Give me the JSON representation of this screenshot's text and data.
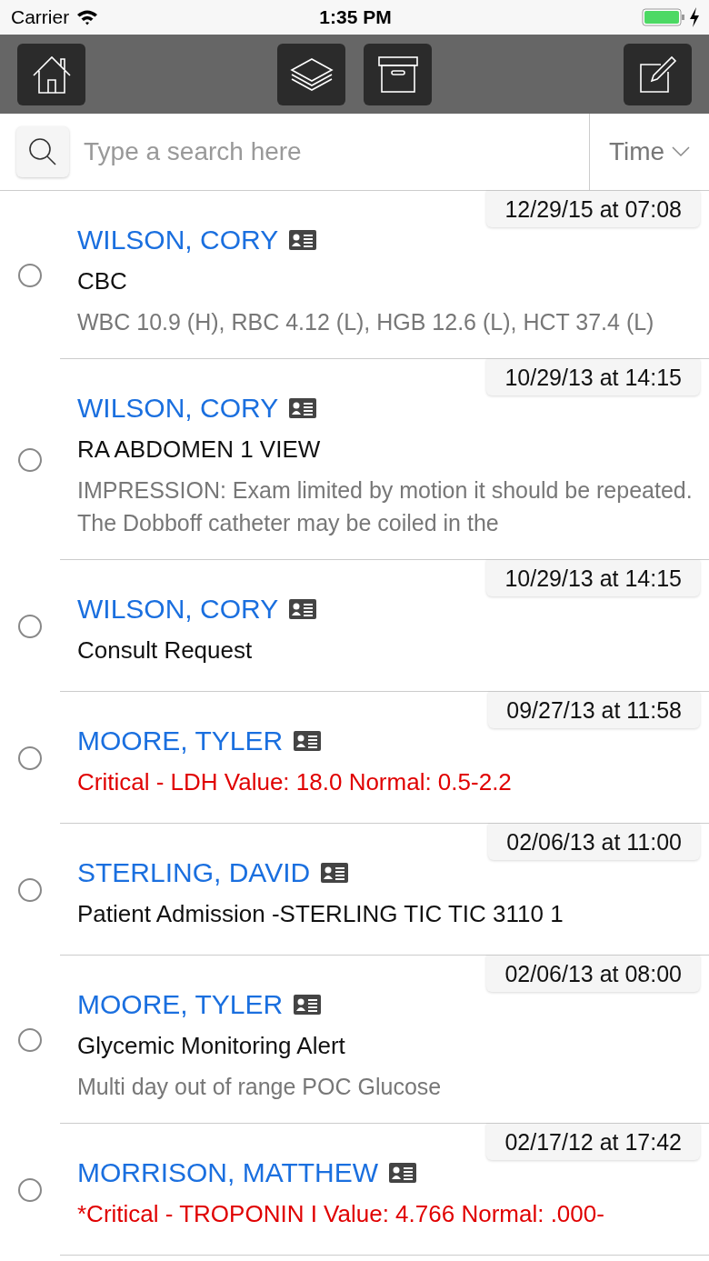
{
  "status_bar": {
    "carrier": "Carrier",
    "time": "1:35 PM",
    "charging": true
  },
  "search": {
    "placeholder": "Type a search here"
  },
  "sort": {
    "label": "Time"
  },
  "messages": [
    {
      "date": "12/29/15 at 07:08",
      "patient": "WILSON, CORY",
      "title": "CBC",
      "kind": "normal",
      "detail": "WBC 10.9 (H), RBC 4.12 (L), HGB 12.6 (L), HCT 37.4 (L)",
      "selected": false
    },
    {
      "date": "10/29/13 at 14:15",
      "patient": "WILSON, CORY",
      "title": "RA ABDOMEN 1 VIEW",
      "kind": "normal",
      "detail": "IMPRESSION: Exam limited by motion it should be repeated. The Dobboff catheter may be coiled in the",
      "selected": false
    },
    {
      "date": "10/29/13 at 14:15",
      "patient": "WILSON, CORY",
      "title": "Consult Request",
      "kind": "normal",
      "selected": false
    },
    {
      "date": "09/27/13 at 11:58",
      "patient": "MOORE, TYLER",
      "title": "Critical - LDH Value: 18.0 Normal: 0.5-2.2",
      "kind": "critical",
      "selected": false
    },
    {
      "date": "02/06/13 at 11:00",
      "patient": "STERLING, DAVID",
      "title": "Patient Admission -STERLING TIC TIC 3110 1",
      "kind": "normal",
      "selected": false
    },
    {
      "date": "02/06/13 at 08:00",
      "patient": "MOORE, TYLER",
      "title": "Glycemic Monitoring Alert",
      "kind": "normal",
      "detail": "Multi day out of range POC Glucose",
      "selected": false
    },
    {
      "date": "02/17/12 at 17:42",
      "patient": "MORRISON, MATTHEW",
      "title": "*Critical - TROPONIN I Value: 4.766 Normal: .000-",
      "kind": "critical",
      "selected": false
    }
  ]
}
